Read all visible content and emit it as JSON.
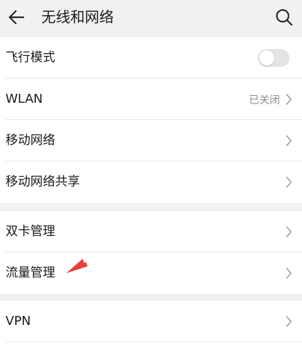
{
  "header": {
    "title": "无线和网络",
    "back_icon": "back-arrow-icon",
    "search_icon": "search-icon"
  },
  "sections": [
    {
      "rows": [
        {
          "label": "飞行模式",
          "control": "toggle",
          "toggle_on": false
        },
        {
          "label": "WLAN",
          "status": "已关闭",
          "control": "chevron"
        },
        {
          "label": "移动网络",
          "control": "chevron"
        },
        {
          "label": "移动网络共享",
          "control": "chevron"
        }
      ]
    },
    {
      "rows": [
        {
          "label": "双卡管理",
          "control": "chevron"
        },
        {
          "label": "流量管理",
          "control": "chevron"
        }
      ]
    },
    {
      "rows": [
        {
          "label": "VPN",
          "control": "chevron"
        }
      ]
    }
  ],
  "annotation": {
    "color": "#e8403a",
    "target": "流量管理"
  },
  "colors": {
    "background": "#f1f1f1",
    "card": "#ffffff",
    "text": "#1a1a1a",
    "secondary_text": "#8c8c8c",
    "toggle_off": "#e4e4e4"
  }
}
